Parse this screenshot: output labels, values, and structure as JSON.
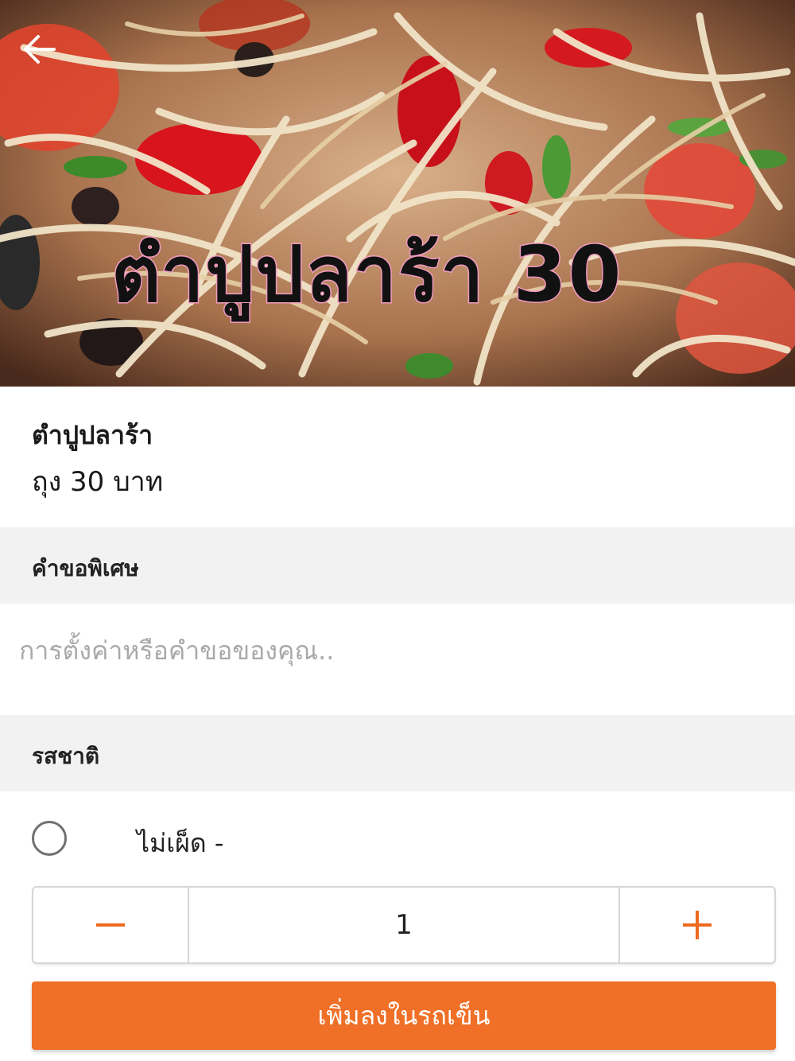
{
  "hero": {
    "caption": "ตำปูปลาร้า 30",
    "back_icon": "arrow-left-icon"
  },
  "item": {
    "name": "ตำปูปลาร้า",
    "price_text": "ถุง 30 บาท"
  },
  "special_request": {
    "title": "คำขอพิเศษ",
    "placeholder": "การตั้งค่าหรือคำขอของคุณ.."
  },
  "flavor": {
    "title": "รสชาติ",
    "options": [
      {
        "label": "ไม่เผ็ด  -",
        "selected": false
      }
    ]
  },
  "quantity": {
    "value": "1",
    "minus_symbol": "−",
    "plus_symbol": "+"
  },
  "add_to_cart": {
    "label": "เพิ่มลงในรถเข็น"
  },
  "colors": {
    "accent": "#f07027",
    "section_bg": "#f2f2f2"
  }
}
